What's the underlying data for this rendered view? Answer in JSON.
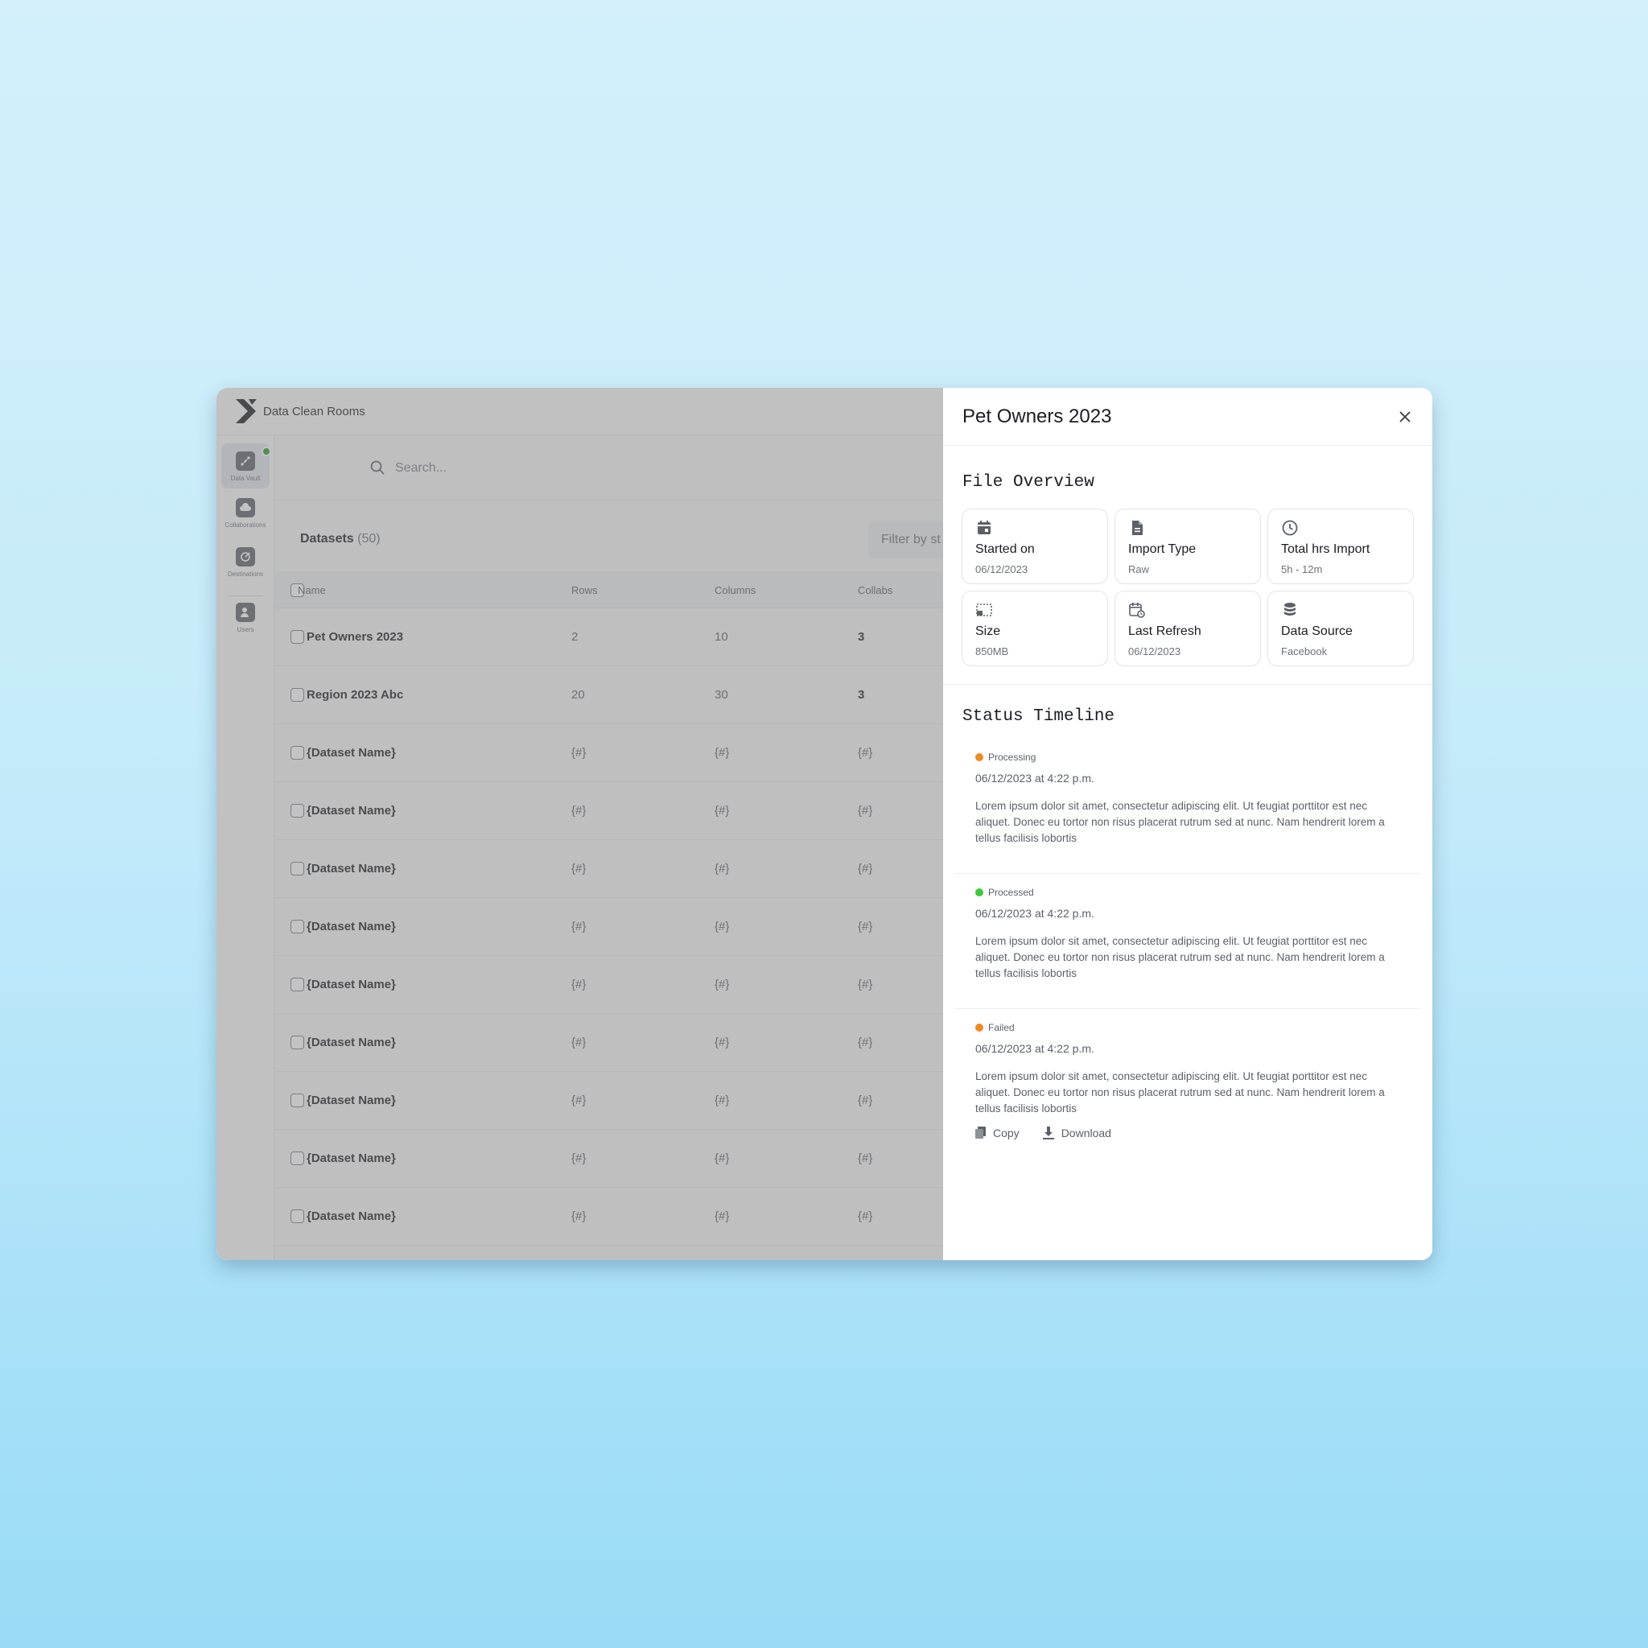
{
  "app": {
    "name": "Data Clean Rooms"
  },
  "sidebar": {
    "items": [
      {
        "label": "Data Vault",
        "icon": "data-vault-icon",
        "active": true
      },
      {
        "label": "Collaborations",
        "icon": "cloud-icon"
      },
      {
        "label": "Destinations",
        "icon": "destination-icon"
      },
      {
        "label": "Users",
        "icon": "user-icon"
      }
    ]
  },
  "search": {
    "placeholder": "Search..."
  },
  "datasets": {
    "title": "Datasets",
    "count": "(50)",
    "filter_placeholder": "Filter by st"
  },
  "table": {
    "headers": [
      "Name",
      "Rows",
      "Columns",
      "Collabs"
    ],
    "rows": [
      [
        "Pet Owners  2023",
        "2",
        "10",
        "3"
      ],
      [
        "Region 2023  Abc",
        "20",
        "30",
        "3"
      ],
      [
        "{Dataset Name}",
        "{#}",
        "{#}",
        "{#}"
      ],
      [
        "{Dataset Name}",
        "{#}",
        "{#}",
        "{#}"
      ],
      [
        "{Dataset Name}",
        "{#}",
        "{#}",
        "{#}"
      ],
      [
        "{Dataset Name}",
        "{#}",
        "{#}",
        "{#}"
      ],
      [
        "{Dataset Name}",
        "{#}",
        "{#}",
        "{#}"
      ],
      [
        "{Dataset Name}",
        "{#}",
        "{#}",
        "{#}"
      ],
      [
        "{Dataset Name}",
        "{#}",
        "{#}",
        "{#}"
      ],
      [
        "{Dataset Name}",
        "{#}",
        "{#}",
        "{#}"
      ],
      [
        "{Dataset Name}",
        "{#}",
        "{#}",
        "{#}"
      ]
    ]
  },
  "drawer": {
    "title": "Pet Owners 2023",
    "overview_title": "File Overview",
    "cards": [
      {
        "label": "Started on",
        "value": "06/12/2023",
        "icon": "calendar-icon"
      },
      {
        "label": "Import Type",
        "value": "Raw",
        "icon": "document-icon"
      },
      {
        "label": "Total hrs Import",
        "value": "5h - 12m",
        "icon": "clock-icon"
      },
      {
        "label": "Size",
        "value": "850MB",
        "icon": "size-icon"
      },
      {
        "label": "Last Refresh",
        "value": "06/12/2023",
        "icon": "calendar-refresh-icon"
      },
      {
        "label": "Data Source",
        "value": "Facebook",
        "icon": "database-icon"
      }
    ],
    "timeline_title": "Status Timeline",
    "timeline": [
      {
        "status": "Processing",
        "color": "#f08a24",
        "date": "06/12/2023 at 4:22 p.m.",
        "text": "Lorem ipsum dolor sit amet, consectetur adipiscing elit. Ut feugiat porttitor est nec aliquet. Donec eu tortor non risus placerat rutrum sed at nunc. Nam hendrerit lorem a tellus facilisis lobortis"
      },
      {
        "status": "Processed",
        "color": "#3fc83f",
        "date": "06/12/2023 at 4:22 p.m.",
        "text": "Lorem ipsum dolor sit amet, consectetur adipiscing elit. Ut feugiat porttitor est nec aliquet. Donec eu tortor non risus placerat rutrum sed at nunc. Nam hendrerit lorem a tellus facilisis lobortis"
      },
      {
        "status": "Failed",
        "color": "#f08a24",
        "date": "06/12/2023 at 4:22 p.m.",
        "text": "Lorem ipsum dolor sit amet, consectetur adipiscing elit. Ut feugiat porttitor est nec aliquet. Donec eu tortor non risus placerat rutrum sed at nunc. Nam hendrerit lorem a tellus facilisis lobortis"
      }
    ],
    "actions": {
      "copy_label": "Copy",
      "download_label": "Download"
    }
  }
}
